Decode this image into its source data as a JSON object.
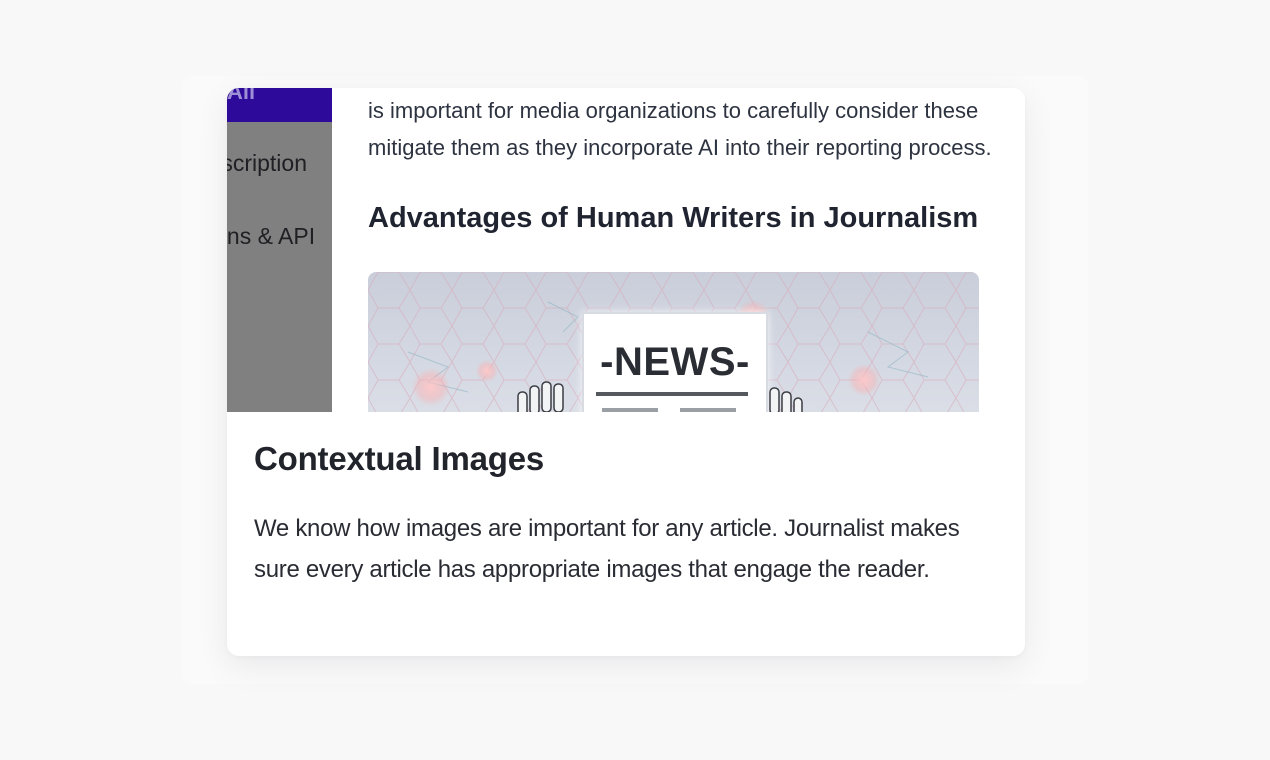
{
  "preview": {
    "sidebar": {
      "active_item": "All",
      "items": [
        "Description",
        "Integrations & API"
      ]
    },
    "article": {
      "lines": [
        "is important for media organizations to carefully consider these",
        "mitigate them as they incorporate AI into their reporting process."
      ],
      "heading": "Advantages of Human Writers in Journalism",
      "image_masthead": "-NEWS-"
    }
  },
  "feature": {
    "title": "Contextual Images",
    "description": "We know how images are important for any article. Journalist makes sure every article has appropriate images that engage the reader."
  },
  "colors": {
    "sidebar_bg": "#808080",
    "sidebar_active_bg": "#2e0a9a",
    "page_bg": "#f8f8f9",
    "card_bg": "#ffffff"
  }
}
